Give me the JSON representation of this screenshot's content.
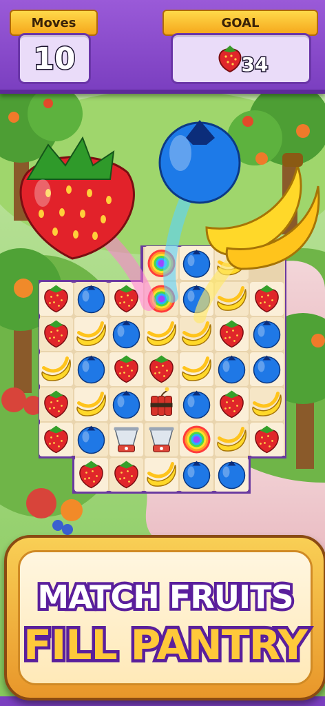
{
  "hud": {
    "moves_label": "Moves",
    "moves_value": "10",
    "goal_label": "GOAL",
    "goal_item": "strawberry",
    "goal_value": "34"
  },
  "board": {
    "rows": [
      [
        null,
        "strawberry",
        "blueberry",
        "strawberry",
        "rainbow",
        "blueberry",
        "banana",
        "strawberry"
      ],
      [
        null,
        "strawberry",
        "banana",
        "blueberry",
        "banana",
        "banana",
        "strawberry",
        "blueberry"
      ],
      [
        null,
        "banana",
        "blueberry",
        "strawberry",
        "strawberry",
        "banana",
        "blueberry",
        "blueberry"
      ],
      [
        null,
        "strawberry",
        "banana",
        "blueberry",
        "dynamite",
        "blueberry",
        "strawberry",
        "banana"
      ],
      [
        null,
        "strawberry",
        "blueberry",
        "blender",
        "blender",
        "rainbow",
        "banana",
        "strawberry"
      ],
      [
        null,
        null,
        "strawberry",
        "strawberry",
        "banana",
        "blueberry",
        "blueberry",
        null
      ]
    ],
    "top_row": [
      null,
      null,
      null,
      null,
      "rainbow",
      "blueberry",
      "banana",
      null
    ]
  },
  "hero_fruits": [
    "strawberry",
    "blueberry",
    "banana"
  ],
  "banner": {
    "line1": "MATCH FRUITS",
    "line2": "FILL PANTRY"
  },
  "colors": {
    "hud_purple": "#8a4ccc",
    "banner_gold": "#f5b43a",
    "text_purple": "#5a1f9c"
  }
}
